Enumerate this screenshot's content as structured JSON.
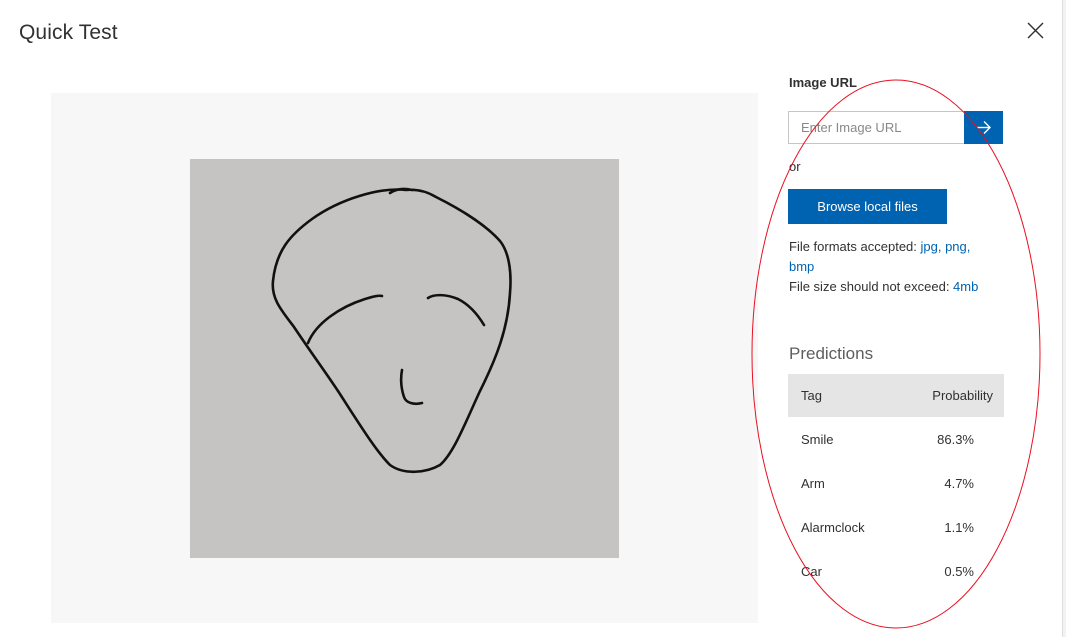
{
  "dialog": {
    "title": "Quick Test",
    "close_icon": "close-icon"
  },
  "image_panel": {
    "image_description_icon": "face-sketch-image"
  },
  "upload": {
    "url_label": "Image URL",
    "url_placeholder": "Enter Image URL",
    "url_value": "",
    "submit_icon": "arrow-right-icon",
    "or_text": "or",
    "browse_label": "Browse local files",
    "formats_prefix": "File formats accepted: ",
    "formats_values": "jpg, png,",
    "formats_wrap": "bmp",
    "size_prefix": "File size should not exceed: ",
    "size_value": "4mb"
  },
  "predictions": {
    "title": "Predictions",
    "columns": [
      "Tag",
      "Probability"
    ],
    "rows": [
      {
        "tag": "Smile",
        "probability": "86.3%"
      },
      {
        "tag": "Arm",
        "probability": "4.7%"
      },
      {
        "tag": "Alarmclock",
        "probability": "1.1%"
      },
      {
        "tag": "Car",
        "probability": "0.5%"
      }
    ]
  },
  "colors": {
    "accent": "#0063b1",
    "annotation_ellipse": "#e81123",
    "photo_background": "#c8c7c6"
  }
}
